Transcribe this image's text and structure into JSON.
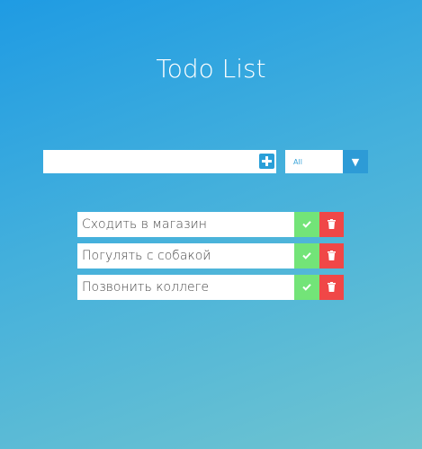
{
  "header": {
    "title": "Todo List"
  },
  "form": {
    "input_value": "",
    "filter_selected": "All",
    "filter_arrow": "▼"
  },
  "todos": [
    {
      "text": "Сходить в магазин"
    },
    {
      "text": "Погулять с собакой"
    },
    {
      "text": "Позвонить коллеге"
    }
  ],
  "icons": {
    "add": "plus-square-icon",
    "complete": "check-icon",
    "delete": "trash-icon"
  },
  "colors": {
    "complete": "#73e478",
    "delete": "#f04747",
    "accent": "#2a9fd8"
  }
}
